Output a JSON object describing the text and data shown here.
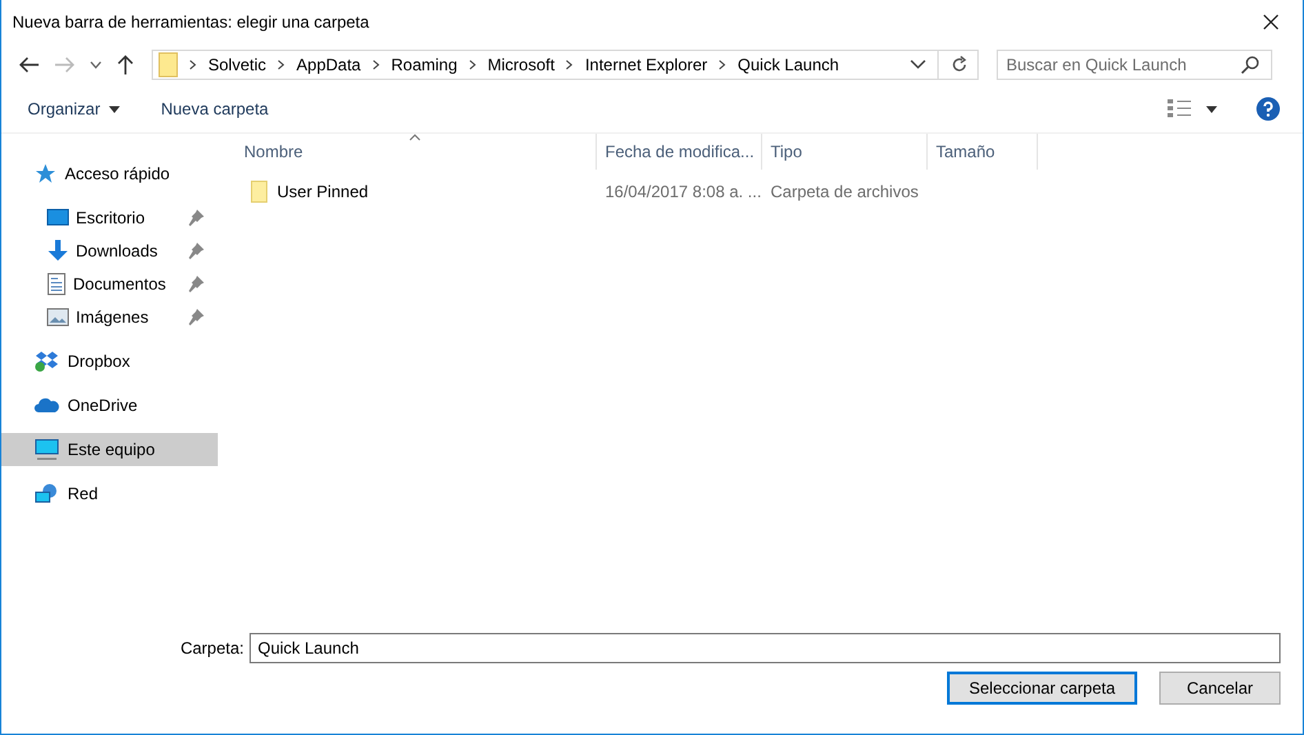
{
  "window": {
    "title": "Nueva barra de herramientas: elegir una carpeta"
  },
  "nav": {
    "breadcrumb": [
      "Solvetic",
      "AppData",
      "Roaming",
      "Microsoft",
      "Internet Explorer",
      "Quick Launch"
    ],
    "search": {
      "placeholder": "Buscar en Quick Launch"
    }
  },
  "toolbar": {
    "organize": "Organizar",
    "new_folder": "Nueva carpeta"
  },
  "sidebar": {
    "items": [
      {
        "label": "Acceso rápido",
        "kind": "star",
        "selected": false,
        "children": [
          {
            "label": "Escritorio",
            "kind": "desktop",
            "pinned": true,
            "selected": false
          },
          {
            "label": "Downloads",
            "kind": "download",
            "pinned": true,
            "selected": false
          },
          {
            "label": "Documentos",
            "kind": "document",
            "pinned": true,
            "selected": false
          },
          {
            "label": "Imágenes",
            "kind": "image",
            "pinned": true,
            "selected": false
          }
        ]
      },
      {
        "label": "Dropbox",
        "kind": "dropbox",
        "selected": false
      },
      {
        "label": "OneDrive",
        "kind": "cloud",
        "selected": false
      },
      {
        "label": "Este equipo",
        "kind": "computer",
        "selected": true
      },
      {
        "label": "Red",
        "kind": "network",
        "selected": false
      }
    ]
  },
  "table": {
    "columns": [
      {
        "label": "Nombre",
        "sorted": true
      },
      {
        "label": "Fecha de modifica..."
      },
      {
        "label": "Tipo"
      },
      {
        "label": "Tamaño"
      }
    ],
    "rows": [
      {
        "kind": "folder",
        "cells": [
          "User Pinned",
          "16/04/2017 8:08 a. ...",
          "Carpeta de archivos",
          ""
        ]
      }
    ]
  },
  "footer": {
    "label": "Carpeta:",
    "value": "Quick Launch",
    "buttons": [
      {
        "label": "Seleccionar carpeta",
        "default": true
      },
      {
        "label": "Cancelar",
        "default": false
      }
    ]
  }
}
